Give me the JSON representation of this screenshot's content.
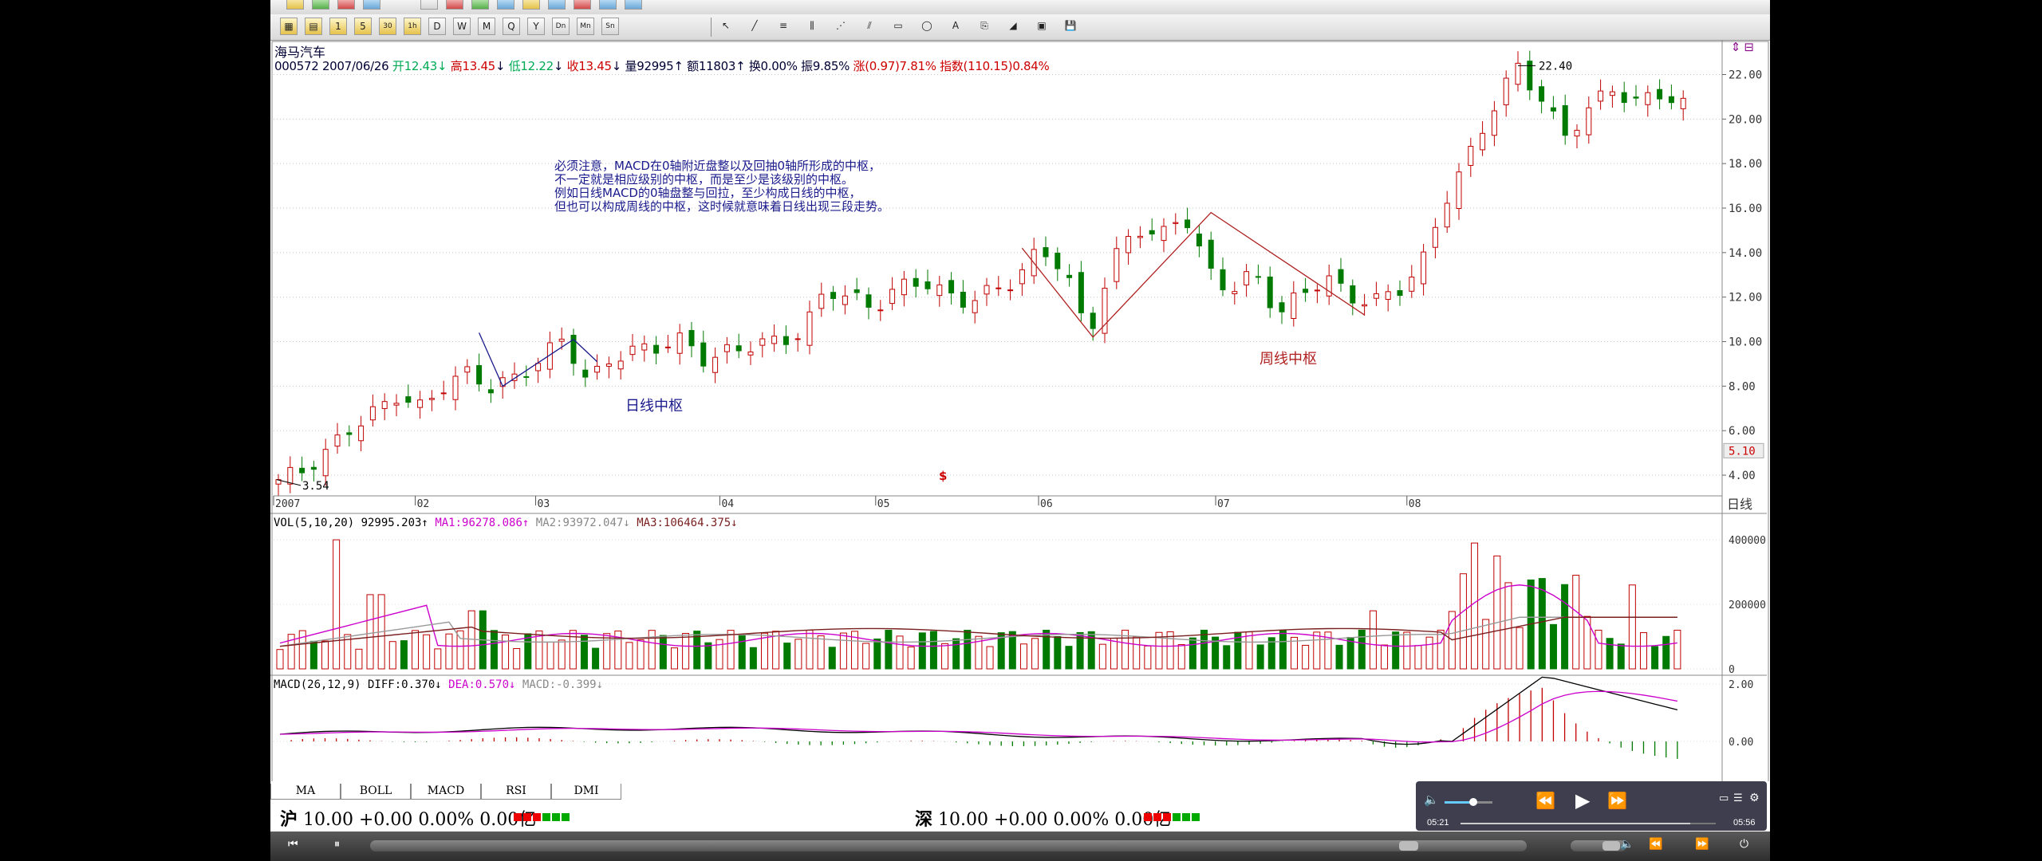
{
  "stock": {
    "name": "海马汽车",
    "code": "000572",
    "date": "2007/06/26",
    "open_label": "开",
    "open": "12.43",
    "high_label": "高",
    "high": "13.45",
    "low_label": "低",
    "low": "12.22",
    "close_label": "收",
    "close": "13.45",
    "volume_label": "量",
    "volume": "92995",
    "amount_label": "额",
    "amount": "11803",
    "turnover_label": "换",
    "turnover": "0.00%",
    "amplitude_label": "振",
    "amplitude": "9.85%",
    "change_label": "涨",
    "change": "(0.97)7.81%",
    "index_label": "指数",
    "index": "(110.15)0.84%"
  },
  "annotations": {
    "note": "必须注意，MACD在0轴附近盘整以及回抽0轴所形成的中枢，\n不一定就是相应级别的中枢，而是至少是该级别的中枢。\n例如日线MACD的0轴盘整与回拉，至少构成日线的中枢，\n但也可以构成周线的中枢，这时候就意味着日线出现三段走势。",
    "daily_pivot": "日线中枢",
    "weekly_pivot": "周线中枢",
    "marker": "$",
    "high_marker": "22.40",
    "low_marker": "3.54"
  },
  "price_axis": {
    "labels": [
      "22.00",
      "20.00",
      "18.00",
      "16.00",
      "14.00",
      "12.00",
      "10.00",
      "8.00",
      "6.00",
      "4.00"
    ],
    "current": "5.10",
    "period": "日线"
  },
  "time_axis": [
    "2007",
    "02",
    "03",
    "04",
    "05",
    "06",
    "07",
    "08"
  ],
  "volume_panel": {
    "title": "VOL(5,10,20)",
    "value": "92995.203",
    "ma1_label": "MA1:",
    "ma1": "96278.086",
    "ma2_label": "MA2:",
    "ma2": "93972.047",
    "ma3_label": "MA3:",
    "ma3": "106464.375",
    "axis": [
      "400000",
      "200000",
      "0"
    ]
  },
  "macd_panel": {
    "title": "MACD(26,12,9)",
    "diff_label": "DIFF:",
    "diff": "0.370",
    "dea_label": "DEA:",
    "dea": "0.570",
    "macd_label": "MACD:",
    "macd": "-0.399",
    "axis": [
      "2.00",
      "0.00"
    ]
  },
  "tabs": [
    "MA",
    "BOLL",
    "MACD",
    "RSI",
    "DMI"
  ],
  "status": {
    "sh_label": "沪",
    "sh_text": "10.00 +0.00 0.00% 0.00亿",
    "sz_label": "深",
    "sz_text": "10.00 +0.00 0.00% 0.00亿"
  },
  "player": {
    "current_time": "05:21",
    "total_time": "05:56",
    "progress": 0.9,
    "volume": 0.6
  },
  "colors": {
    "up": "#c00000",
    "down": "#007a00",
    "ma_magenta": "#cc00cc",
    "ma_brown": "#7a1f1f",
    "annotation_blue": "#1a1a8c"
  },
  "chart_data": {
    "type": "candlestick",
    "title": "海马汽车",
    "ylim": [
      3.5,
      23.2
    ],
    "x": [
      "2007",
      "02",
      "03",
      "04",
      "05",
      "06",
      "07",
      "08"
    ],
    "key_points": [
      {
        "label": "low",
        "value": 3.54
      },
      {
        "label": "high",
        "value": 22.4
      }
    ],
    "close_path": [
      3.8,
      4.2,
      5.0,
      6.1,
      6.8,
      7.6,
      7.0,
      8.1,
      8.6,
      7.9,
      8.4,
      9.2,
      10.2,
      8.1,
      9.3,
      9.6,
      9.8,
      10.1,
      9.1,
      9.6,
      9.9,
      10.0,
      10.4,
      12.4,
      12.0,
      11.5,
      12.4,
      12.8,
      12.1,
      11.8,
      12.3,
      12.8,
      14.2,
      13.3,
      10.2,
      13.5,
      15.2,
      14.6,
      15.9,
      13.2,
      12.3,
      13.1,
      11.2,
      12.2,
      12.9,
      12.0,
      11.8,
      12.3,
      13.4,
      16.4,
      18.3,
      20.5,
      22.4,
      21.0,
      19.2,
      20.4,
      21.4,
      20.7,
      21.2,
      20.6
    ],
    "volume_bars": 125
  }
}
